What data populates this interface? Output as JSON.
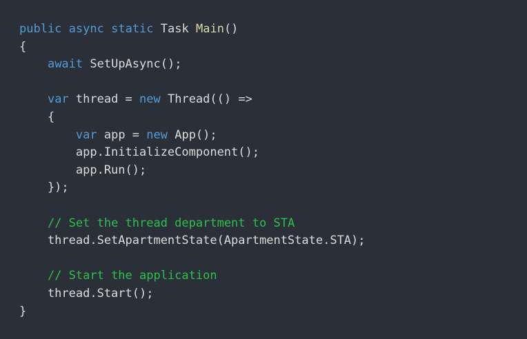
{
  "colors": {
    "background": "#2b2f37",
    "keyword": "#569cd6",
    "function": "#dcdcaa",
    "text": "#dcdcdc",
    "comment": "#2fbf4f"
  },
  "code": {
    "lines": [
      [
        {
          "t": "public",
          "c": "kw"
        },
        {
          "t": " ",
          "c": "plain"
        },
        {
          "t": "async",
          "c": "kw"
        },
        {
          "t": " ",
          "c": "plain"
        },
        {
          "t": "static",
          "c": "kw"
        },
        {
          "t": " ",
          "c": "plain"
        },
        {
          "t": "Task",
          "c": "type"
        },
        {
          "t": " ",
          "c": "plain"
        },
        {
          "t": "Main",
          "c": "fn"
        },
        {
          "t": "()",
          "c": "punc"
        }
      ],
      [
        {
          "t": "{",
          "c": "punc"
        }
      ],
      [
        {
          "t": "    ",
          "c": "plain"
        },
        {
          "t": "await",
          "c": "kw"
        },
        {
          "t": " SetUpAsync();",
          "c": "plain"
        }
      ],
      [],
      [
        {
          "t": "    ",
          "c": "plain"
        },
        {
          "t": "var",
          "c": "kw"
        },
        {
          "t": " thread = ",
          "c": "plain"
        },
        {
          "t": "new",
          "c": "kw"
        },
        {
          "t": " Thread(() =>",
          "c": "plain"
        }
      ],
      [
        {
          "t": "    {",
          "c": "punc"
        }
      ],
      [
        {
          "t": "        ",
          "c": "plain"
        },
        {
          "t": "var",
          "c": "kw"
        },
        {
          "t": " app = ",
          "c": "plain"
        },
        {
          "t": "new",
          "c": "kw"
        },
        {
          "t": " App();",
          "c": "plain"
        }
      ],
      [
        {
          "t": "        app.InitializeComponent();",
          "c": "plain"
        }
      ],
      [
        {
          "t": "        app.Run();",
          "c": "plain"
        }
      ],
      [
        {
          "t": "    });",
          "c": "punc"
        }
      ],
      [],
      [
        {
          "t": "    ",
          "c": "plain"
        },
        {
          "t": "// Set the thread department to STA",
          "c": "comment"
        }
      ],
      [
        {
          "t": "    thread.SetApartmentState(ApartmentState.STA);",
          "c": "plain"
        }
      ],
      [],
      [
        {
          "t": "    ",
          "c": "plain"
        },
        {
          "t": "// Start the application",
          "c": "comment"
        }
      ],
      [
        {
          "t": "    thread.Start();",
          "c": "plain"
        }
      ],
      [
        {
          "t": "}",
          "c": "punc"
        }
      ]
    ]
  }
}
